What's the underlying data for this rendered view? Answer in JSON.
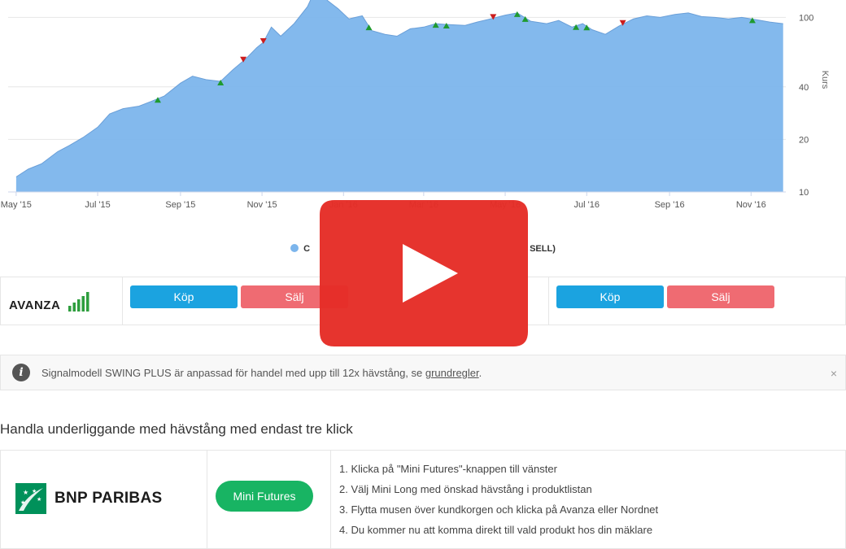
{
  "chart_data": {
    "type": "area",
    "series": [
      {
        "name": "",
        "x": [
          "2015-05-01",
          "2015-05-10",
          "2015-05-20",
          "2015-06-01",
          "2015-06-10",
          "2015-06-20",
          "2015-07-01",
          "2015-07-10",
          "2015-07-20",
          "2015-08-01",
          "2015-08-10",
          "2015-08-20",
          "2015-09-01",
          "2015-09-10",
          "2015-09-20",
          "2015-10-01",
          "2015-10-10",
          "2015-10-20",
          "2015-10-28",
          "2015-11-02",
          "2015-11-08",
          "2015-11-15",
          "2015-11-25",
          "2015-12-05",
          "2015-12-12",
          "2015-12-20",
          "2015-12-28",
          "2016-01-05",
          "2016-01-15",
          "2016-01-22",
          "2016-02-01",
          "2016-02-10",
          "2016-02-20",
          "2016-03-01",
          "2016-03-10",
          "2016-03-20",
          "2016-04-01",
          "2016-04-10",
          "2016-04-20",
          "2016-05-01",
          "2016-05-10",
          "2016-05-20",
          "2016-06-01",
          "2016-06-10",
          "2016-06-20",
          "2016-06-28",
          "2016-07-05",
          "2016-07-15",
          "2016-07-25",
          "2016-08-05",
          "2016-08-15",
          "2016-08-25",
          "2016-09-05",
          "2016-09-15",
          "2016-09-25",
          "2016-10-05",
          "2016-10-15",
          "2016-10-25",
          "2016-11-05",
          "2016-11-15",
          "2016-11-25"
        ],
        "y": [
          12.2,
          13.5,
          14.5,
          17,
          18.5,
          20.5,
          23.5,
          28,
          30,
          31,
          33,
          35.5,
          42,
          46,
          44,
          43,
          50,
          58,
          67,
          72,
          88,
          78,
          92,
          115,
          150,
          125,
          112,
          98,
          102,
          84,
          80,
          78,
          86,
          88,
          92,
          91,
          90,
          94,
          98,
          103,
          106,
          95,
          92,
          96,
          88,
          92,
          85,
          80,
          89,
          98,
          102,
          100,
          104,
          106,
          101,
          100,
          98,
          100,
          97,
          94,
          92
        ]
      }
    ],
    "ylim": [
      10,
      140
    ],
    "yscale": "log",
    "yticks": [
      10,
      20,
      40,
      100
    ],
    "ylabel": "Kurs",
    "xticks": [
      "May '15",
      "Jul '15",
      "Sep '15",
      "Nov '15",
      "Jan '16",
      "Mar '16",
      "May '16",
      "Jul '16",
      "Sep '16",
      "Nov '16"
    ],
    "xtick_dates": [
      "2015-05-01",
      "2015-07-01",
      "2015-09-01",
      "2015-11-01",
      "2016-01-01",
      "2016-03-01",
      "2016-05-01",
      "2016-07-01",
      "2016-09-01",
      "2016-11-01"
    ],
    "xlim": [
      "2015-04-25",
      "2016-11-27"
    ],
    "buy_signals": [
      "2015-08-15",
      "2015-10-01",
      "2016-01-20",
      "2016-03-10",
      "2016-03-18",
      "2016-05-10",
      "2016-05-16",
      "2016-06-23",
      "2016-07-01",
      "2016-11-02"
    ],
    "sell_signals": [
      "2015-10-18",
      "2015-11-02",
      "2015-12-18",
      "2016-04-22",
      "2016-07-28"
    ],
    "grid": true,
    "colors": {
      "area": "#7cb5ec",
      "line": "#6a9fd8",
      "buy": "#1f9a2f",
      "sell": "#cc1d1d"
    }
  },
  "legend": {
    "label_prefix": "C",
    "label_suffix": "SELL)"
  },
  "brokers": {
    "avanza_logo_text": "AVANZA",
    "buy_label": "Köp",
    "sell_label": "Sälj",
    "buy_label_2": "Köp",
    "sell_label_2": "Sälj"
  },
  "info": {
    "text": "Signalmodell SWING PLUS är anpassad för handel med upp till 12x hävstång, se ",
    "link": "grundregler",
    "suffix": ".",
    "close": "×"
  },
  "section": {
    "heading": "Handla underliggande med hävstång med endast tre klick"
  },
  "leverage": {
    "bnp_text": "BNP PARIBAS",
    "button": "Mini Futures",
    "steps": [
      "1. Klicka på \"Mini Futures\"-knappen till vänster",
      "2. Välj Mini Long med önskad hävstång i produktlistan",
      "3. Flytta musen över kundkorgen och klicka på Avanza eller Nordnet",
      "4. Du kommer nu att komma direkt till vald produkt hos din mäklare"
    ]
  },
  "overlay": {
    "play_icon": "play-icon",
    "color": "#e52d27"
  }
}
